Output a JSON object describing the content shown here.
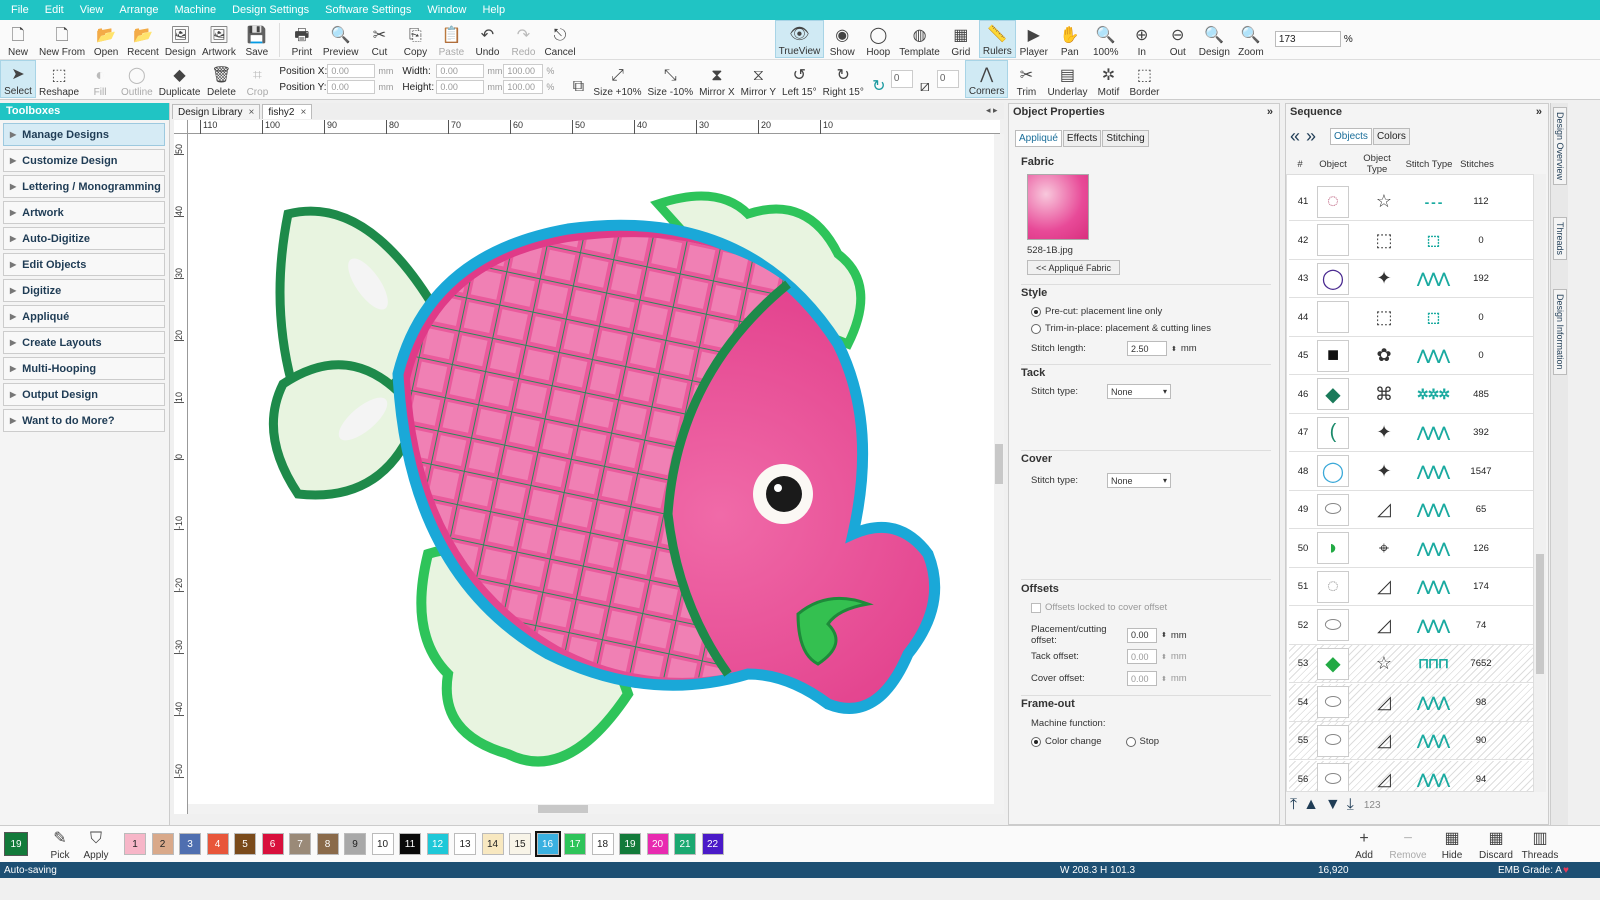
{
  "menu": [
    "File",
    "Edit",
    "View",
    "Arrange",
    "Machine",
    "Design Settings",
    "Software Settings",
    "Window",
    "Help"
  ],
  "ribbon1": {
    "file_tools": [
      {
        "label": "New",
        "icon": "new-document-icon",
        "g": "🗋"
      },
      {
        "label": "New From",
        "icon": "new-from-icon",
        "g": "🗋"
      },
      {
        "label": "Open",
        "icon": "open-folder-icon",
        "g": "📂"
      },
      {
        "label": "Recent",
        "icon": "recent-folder-icon",
        "g": "📂"
      },
      {
        "label": "Design",
        "icon": "design-icon",
        "g": "🖼"
      },
      {
        "label": "Artwork",
        "icon": "artwork-icon",
        "g": "🖼"
      },
      {
        "label": "Save",
        "icon": "save-icon",
        "g": "💾"
      }
    ],
    "edit_tools": [
      {
        "label": "Print",
        "icon": "print-icon",
        "g": "🖶",
        "dis": false
      },
      {
        "label": "Preview",
        "icon": "preview-icon",
        "g": "🔍",
        "dis": false
      },
      {
        "label": "Cut",
        "icon": "cut-icon",
        "g": "✂",
        "dis": false
      },
      {
        "label": "Copy",
        "icon": "copy-icon",
        "g": "⎘",
        "dis": false
      },
      {
        "label": "Paste",
        "icon": "paste-icon",
        "g": "📋",
        "dis": true
      },
      {
        "label": "Undo",
        "icon": "undo-icon",
        "g": "↶",
        "dis": false
      },
      {
        "label": "Redo",
        "icon": "redo-icon",
        "g": "↷",
        "dis": true
      },
      {
        "label": "Cancel",
        "icon": "escape-icon",
        "g": "⎋",
        "dis": false
      }
    ],
    "view_tools": [
      {
        "label": "TrueView",
        "icon": "trueview-icon",
        "g": "👁",
        "act": true
      },
      {
        "label": "Show",
        "icon": "show-icon",
        "g": "◉"
      },
      {
        "label": "Hoop",
        "icon": "hoop-icon",
        "g": "◯"
      },
      {
        "label": "Template",
        "icon": "template-icon",
        "g": "◍"
      },
      {
        "label": "Grid",
        "icon": "grid-icon",
        "g": "▦"
      },
      {
        "label": "Rulers",
        "icon": "rulers-icon",
        "g": "📏",
        "act": true
      },
      {
        "label": "Player",
        "icon": "player-icon",
        "g": "▶"
      },
      {
        "label": "Pan",
        "icon": "pan-hand-icon",
        "g": "✋"
      },
      {
        "label": "100%",
        "icon": "zoom-100-icon",
        "g": "🔍"
      },
      {
        "label": "In",
        "icon": "zoom-in-icon",
        "g": "⊕"
      },
      {
        "label": "Out",
        "icon": "zoom-out-icon",
        "g": "⊖"
      },
      {
        "label": "Design",
        "icon": "zoom-design-icon",
        "g": "🔍"
      },
      {
        "label": "Zoom",
        "icon": "zoom-icon",
        "g": "🔍"
      }
    ],
    "zoom_value": "173",
    "zoom_unit": "%"
  },
  "ribbon2": {
    "left_tools": [
      {
        "label": "Select",
        "icon": "select-arrow-icon",
        "g": "➤",
        "act": true
      },
      {
        "label": "Reshape",
        "icon": "reshape-icon",
        "g": "⬚"
      },
      {
        "label": "Fill",
        "icon": "fill-icon",
        "g": "◐",
        "dis": true
      },
      {
        "label": "Outline",
        "icon": "outline-icon",
        "g": "◯",
        "dis": true
      },
      {
        "label": "Duplicate",
        "icon": "duplicate-icon",
        "g": "◆"
      },
      {
        "label": "Delete",
        "icon": "delete-icon",
        "g": "🗑"
      },
      {
        "label": "Crop",
        "icon": "crop-icon",
        "g": "⌗",
        "dis": true
      }
    ],
    "position_x_label": "Position X:",
    "position_y_label": "Position Y:",
    "position_x": "0.00",
    "position_y": "0.00",
    "width_label": "Width:",
    "height_label": "Height:",
    "width": "0.00",
    "height": "0.00",
    "width_pct": "100.00",
    "height_pct": "100.00",
    "unit": "mm",
    "pct": "%",
    "right_tools": [
      {
        "label": "Size +10%",
        "icon": "size-plus-icon",
        "g": "⤢"
      },
      {
        "label": "Size -10%",
        "icon": "size-minus-icon",
        "g": "⤡"
      },
      {
        "label": "Mirror X",
        "icon": "mirror-x-icon",
        "g": "⧗"
      },
      {
        "label": "Mirror Y",
        "icon": "mirror-y-icon",
        "g": "⧖"
      },
      {
        "label": "Left 15°",
        "icon": "rotate-left-icon",
        "g": "↺"
      },
      {
        "label": "Right 15°",
        "icon": "rotate-right-icon",
        "g": "↻"
      }
    ],
    "rotate_value": "0",
    "skew_value": "0",
    "stitch_tools": [
      {
        "label": "Corners",
        "icon": "corners-icon",
        "g": "⋀",
        "act": true
      },
      {
        "label": "Trim",
        "icon": "trim-icon",
        "g": "✂"
      },
      {
        "label": "Underlay",
        "icon": "underlay-icon",
        "g": "▤"
      },
      {
        "label": "Motif",
        "icon": "motif-icon",
        "g": "✲"
      },
      {
        "label": "Border",
        "icon": "border-icon",
        "g": "⬚"
      }
    ]
  },
  "toolboxes": {
    "title": "Toolboxes",
    "items": [
      "Manage Designs",
      "Customize Design",
      "Lettering / Monogramming",
      "Artwork",
      "Auto-Digitize",
      "Edit Objects",
      "Digitize",
      "Appliqué",
      "Create Layouts",
      "Multi-Hooping",
      "Output Design",
      "Want to do More?"
    ]
  },
  "doc_tabs": [
    "Design Library",
    "fishy2"
  ],
  "ruler_h": [
    "110",
    "100",
    "90",
    "80",
    "70",
    "60",
    "50",
    "40",
    "30",
    "20",
    "10"
  ],
  "ruler_v": [
    "50",
    "40",
    "30",
    "20",
    "10",
    "0",
    "-10",
    "-20",
    "-30",
    "-40",
    "-50"
  ],
  "props": {
    "title": "Object Properties",
    "tabs": [
      "Appliqué",
      "Effects",
      "Stitching"
    ],
    "fabric_label": "Fabric",
    "fabric_file": "528-1B.jpg",
    "fabric_button": "<< Appliqué Fabric",
    "style_label": "Style",
    "style_opt1": "Pre-cut: placement line only",
    "style_opt2": "Trim-in-place: placement & cutting lines",
    "stitch_length_label": "Stitch length:",
    "stitch_length": "2.50",
    "mm": "mm",
    "tack_label": "Tack",
    "stitch_type_label": "Stitch type:",
    "tack_value": "None",
    "cover_label": "Cover",
    "cover_value": "None",
    "offsets_label": "Offsets",
    "offsets_locked": "Offsets locked to cover offset",
    "placement_label": "Placement/cutting offset:",
    "placement_value": "0.00",
    "tack_offset_label": "Tack offset:",
    "tack_offset": "0.00",
    "cover_offset_label": "Cover offset:",
    "cover_offset": "0.00",
    "frameout_label": "Frame-out",
    "machine_function_label": "Machine function:",
    "color_change": "Color change",
    "stop": "Stop"
  },
  "sequence": {
    "title": "Sequence",
    "tabs": [
      "Objects",
      "Colors"
    ],
    "columns": [
      "#",
      "Object",
      "Object Type",
      "Stitch Type",
      "Stitches"
    ],
    "rows": [
      {
        "n": "41",
        "ot": "☆",
        "st": "- - -",
        "s": "112",
        "th": "◌",
        "thc": "#b44c6e"
      },
      {
        "n": "42",
        "ot": "⬚",
        "st": "⬚",
        "s": "0",
        "th": "",
        "thc": "#b44c6e"
      },
      {
        "n": "43",
        "ot": "✦",
        "st": "⋀⋀⋀",
        "s": "192",
        "th": "◯",
        "thc": "#4a2a90"
      },
      {
        "n": "44",
        "ot": "⬚",
        "st": "⬚",
        "s": "0",
        "th": "",
        "thc": "#b44c6e"
      },
      {
        "n": "45",
        "ot": "✿",
        "st": "⋀⋀⋀",
        "s": "0",
        "th": "■",
        "thc": "#111"
      },
      {
        "n": "46",
        "ot": "⌘",
        "st": "✲✲✲",
        "s": "485",
        "th": "◆",
        "thc": "#1a7a5a"
      },
      {
        "n": "47",
        "ot": "✦",
        "st": "⋀⋀⋀",
        "s": "392",
        "th": "(",
        "thc": "#1a8a6a"
      },
      {
        "n": "48",
        "ot": "✦",
        "st": "⋀⋀⋀",
        "s": "1547",
        "th": "◯",
        "thc": "#3aa8d8"
      },
      {
        "n": "49",
        "ot": "◿",
        "st": "⋀⋀⋀",
        "s": "65",
        "th": "⬭",
        "thc": "#888"
      },
      {
        "n": "50",
        "ot": "⌖",
        "st": "⋀⋀⋀",
        "s": "126",
        "th": "◗",
        "thc": "#22aa44"
      },
      {
        "n": "51",
        "ot": "◿",
        "st": "⋀⋀⋀",
        "s": "174",
        "th": "◌",
        "thc": "#888"
      },
      {
        "n": "52",
        "ot": "◿",
        "st": "⋀⋀⋀",
        "s": "74",
        "th": "⬭",
        "thc": "#888"
      },
      {
        "n": "53",
        "ot": "☆",
        "st": "⊓⊓⊓",
        "s": "7652",
        "th": "◆",
        "thc": "#22aa44"
      },
      {
        "n": "54",
        "ot": "◿",
        "st": "⋀⋀⋀",
        "s": "98",
        "th": "⬭",
        "thc": "#888"
      },
      {
        "n": "55",
        "ot": "◿",
        "st": "⋀⋀⋀",
        "s": "90",
        "th": "⬭",
        "thc": "#888"
      },
      {
        "n": "56",
        "ot": "◿",
        "st": "⋀⋀⋀",
        "s": "94",
        "th": "⬭",
        "thc": "#888"
      }
    ],
    "count_label": "123"
  },
  "side_tabs": [
    "Design Overview",
    "Threads",
    "Design Information"
  ],
  "bottom": {
    "current_color": "19",
    "pick": "Pick",
    "apply": "Apply",
    "swatches": [
      {
        "n": "1",
        "c": "#f7b6c8"
      },
      {
        "n": "2",
        "c": "#d9a98a"
      },
      {
        "n": "3",
        "c": "#4f6fb0"
      },
      {
        "n": "4",
        "c": "#e8563a"
      },
      {
        "n": "5",
        "c": "#7a4a1a"
      },
      {
        "n": "6",
        "c": "#d8103c"
      },
      {
        "n": "7",
        "c": "#9a8a78"
      },
      {
        "n": "8",
        "c": "#8a6a4a"
      },
      {
        "n": "9",
        "c": "#a8a8a8"
      },
      {
        "n": "10",
        "c": "#ffffff"
      },
      {
        "n": "11",
        "c": "#0a0a0a"
      },
      {
        "n": "12",
        "c": "#1ec8d8"
      },
      {
        "n": "13",
        "c": "#ffffff"
      },
      {
        "n": "14",
        "c": "#f8e8c0"
      },
      {
        "n": "15",
        "c": "#f8f4e8"
      },
      {
        "n": "16",
        "c": "#3ab0e0"
      },
      {
        "n": "17",
        "c": "#2ec45a"
      },
      {
        "n": "18",
        "c": "#ffffff"
      },
      {
        "n": "19",
        "c": "#127a3a"
      },
      {
        "n": "20",
        "c": "#e82ab0"
      },
      {
        "n": "21",
        "c": "#1aa870"
      },
      {
        "n": "22",
        "c": "#4a1ac8"
      }
    ],
    "right": [
      {
        "label": "Add",
        "icon": "add-icon",
        "g": "+"
      },
      {
        "label": "Remove",
        "icon": "remove-icon",
        "g": "−",
        "dis": true
      },
      {
        "label": "Hide",
        "icon": "hide-icon",
        "g": "▦"
      },
      {
        "label": "Discard",
        "icon": "discard-icon",
        "g": "▦"
      },
      {
        "label": "Threads",
        "icon": "threads-icon",
        "g": "▥"
      }
    ]
  },
  "status": {
    "left": "Auto-saving",
    "dims": "W 208.3 H 101.3",
    "count": "16,920",
    "grade": "EMB Grade: A"
  }
}
